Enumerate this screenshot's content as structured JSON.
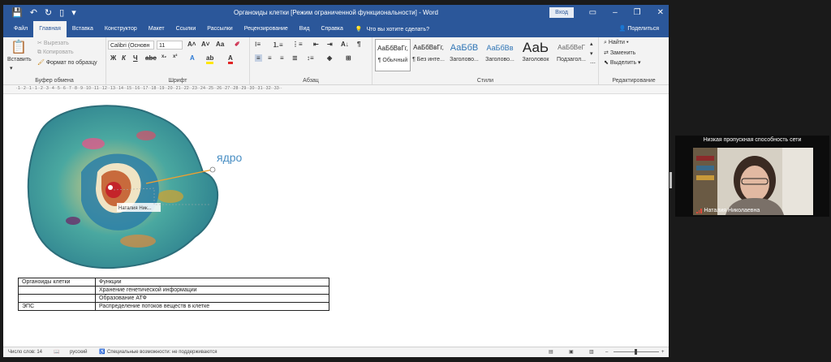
{
  "window": {
    "title": "Органоиды клетки [Режим ограниченной функциональности]  -  Word",
    "signin": "Вход",
    "share": "Поделиться",
    "tell_me": "Что вы хотите сделать?"
  },
  "tabs": [
    "Файл",
    "Главная",
    "Вставка",
    "Конструктор",
    "Макет",
    "Ссылки",
    "Рассылки",
    "Рецензирование",
    "Вид",
    "Справка"
  ],
  "ribbon": {
    "clipboard": {
      "paste": "Вставить",
      "cut": "Вырезать",
      "copy": "Копировать",
      "format_painter": "Формат по образцу",
      "label": "Буфер обмена"
    },
    "font": {
      "font_name": "Calibri (Основн",
      "font_size": "11",
      "label": "Шрифт"
    },
    "paragraph": {
      "label": "Абзац"
    },
    "styles": {
      "items": [
        {
          "preview": "АаБбВвГг,",
          "name": "¶ Обычный"
        },
        {
          "preview": "АаБбВвГг,",
          "name": "¶ Без инте..."
        },
        {
          "preview": "АаБбВ",
          "name": "Заголово..."
        },
        {
          "preview": "АаБбВв",
          "name": "Заголово..."
        },
        {
          "preview": "АаЬ",
          "name": "Заголовок"
        },
        {
          "preview": "АаБбВеГ",
          "name": "Подзагол..."
        }
      ],
      "label": "Стили"
    },
    "editing": {
      "find": "Найти",
      "replace": "Заменить",
      "select": "Выделить",
      "label": "Редактирование"
    }
  },
  "document": {
    "label_nucleus": "ядро",
    "pointer_name": "Наталия Ник...",
    "table": [
      [
        "Органоиды клетки",
        "Функции"
      ],
      [
        "",
        "Хранение генетической информации"
      ],
      [
        "",
        "Образование АТФ"
      ],
      [
        "ЭПС",
        "Распределение потоков веществ в клетке"
      ]
    ]
  },
  "statusbar": {
    "word_count": "Число слов: 14",
    "language": "русский",
    "accessibility": "Специальные возможности: не поддерживаются",
    "zoom": "100 %"
  },
  "video": {
    "network_warning": "Низкая пропускная способность сети",
    "participant": "Наталия Николаевна"
  },
  "colors": {
    "word_blue": "#2b579a",
    "label_blue": "#4a8fc4"
  }
}
